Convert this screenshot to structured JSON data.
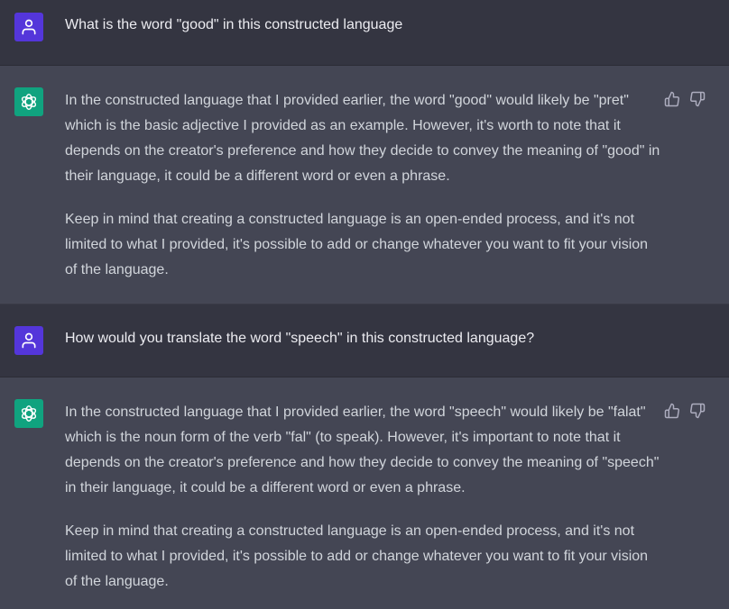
{
  "conversation": [
    {
      "role": "user",
      "text": "What is the word \"good\" in this constructed language"
    },
    {
      "role": "assistant",
      "paragraphs": [
        "In the constructed language that I provided earlier, the word \"good\" would likely be \"pret\" which is the basic adjective I provided as an example. However, it's worth to note that it depends on the creator's preference and how they decide to convey the meaning of \"good\" in their language, it could be a different word or even a phrase.",
        "Keep in mind that creating a constructed language is an open-ended process, and it's not limited to what I provided, it's possible to add or change whatever you want to fit your vision of the language."
      ]
    },
    {
      "role": "user",
      "text": "How would you translate the word \"speech\" in this constructed language?"
    },
    {
      "role": "assistant",
      "paragraphs": [
        "In the constructed language that I provided earlier, the word \"speech\" would likely be \"falat\" which is the noun form of the verb \"fal\" (to speak). However, it's important to note that it depends on the creator's preference and how they decide to convey the meaning of \"speech\" in their language, it could be a different word or even a phrase.",
        "Keep in mind that creating a constructed language is an open-ended process, and it's not limited to what I provided, it's possible to add or change whatever you want to fit your vision of the language."
      ]
    }
  ],
  "icons": {
    "user_avatar": "user-icon",
    "assistant_avatar": "openai-logo-icon",
    "thumbs_up": "thumbs-up-icon",
    "thumbs_down": "thumbs-down-icon"
  },
  "colors": {
    "user_bg": "#343541",
    "assistant_bg": "#444654",
    "user_avatar_bg": "#5436da",
    "assistant_avatar_bg": "#10a37f",
    "text": "#d1d5db"
  }
}
